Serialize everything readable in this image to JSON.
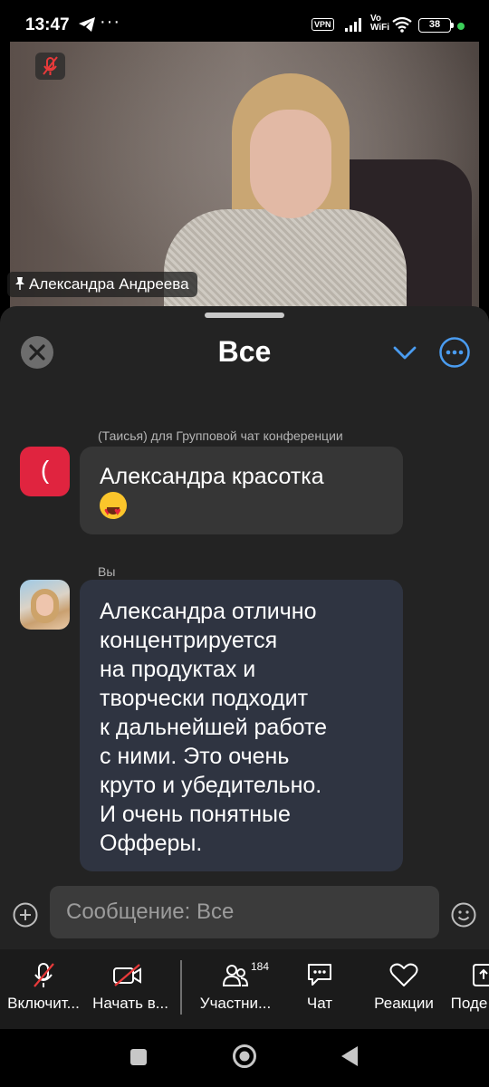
{
  "status_bar": {
    "time": "13:47",
    "vpn": "VPN",
    "vowifi": "Vo\nWiFi",
    "battery": "38",
    "more": "···"
  },
  "video": {
    "participant_name": "Александра Андреева"
  },
  "chat": {
    "title": "Все",
    "messages": [
      {
        "meta": "(Таисья) для Групповой чат конференции",
        "avatar_text": "(",
        "text": "Александра красотка"
      },
      {
        "meta": "Вы",
        "text": "Александра отлично\nконцентрируется\nна продуктах и\nтворчески подходит\nк дальнейшей работе\nс ними. Это очень\nкруто и убедительно.\nИ очень понятные\nОфферы."
      }
    ],
    "composer_placeholder": "Сообщение: Все"
  },
  "toolbar": {
    "items": [
      {
        "label": "Включит...",
        "icon": "mic-off-icon"
      },
      {
        "label": "Начать в...",
        "icon": "video-off-icon"
      },
      {
        "label": "Участни...",
        "icon": "participants-icon",
        "badge": "184"
      },
      {
        "label": "Чат",
        "icon": "chat-icon"
      },
      {
        "label": "Реакции",
        "icon": "heart-icon"
      },
      {
        "label": "Поде",
        "icon": "share-icon"
      }
    ]
  },
  "colors": {
    "accent": "#4a9cf0",
    "sheet_bg": "#232323",
    "my_bubble": "#2f3441",
    "other_bubble": "#363636",
    "red": "#e0243f"
  }
}
